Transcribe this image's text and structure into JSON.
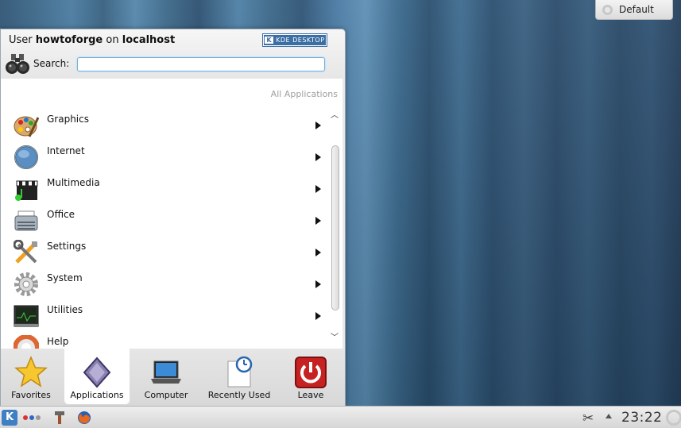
{
  "activity": {
    "label": "Default"
  },
  "launcher": {
    "user_prefix": "User",
    "username": "howtoforge",
    "host_prefix": "on",
    "hostname": "localhost",
    "badge": {
      "k": "K",
      "text": "KDE DESKTOP"
    },
    "search_label": "Search:",
    "search_value": "",
    "breadcrumb": "All Applications",
    "items": [
      {
        "label": "Graphics",
        "icon": "palette-icon"
      },
      {
        "label": "Internet",
        "icon": "globe-icon"
      },
      {
        "label": "Multimedia",
        "icon": "clapperboard-icon"
      },
      {
        "label": "Office",
        "icon": "typewriter-icon"
      },
      {
        "label": "Settings",
        "icon": "tools-icon"
      },
      {
        "label": "System",
        "icon": "gear-icon"
      },
      {
        "label": "Utilities",
        "icon": "terminal-icon"
      },
      {
        "label": "Help",
        "icon": "lifebuoy-icon"
      }
    ],
    "tabs": [
      {
        "label": "Favorites",
        "icon": "star-icon"
      },
      {
        "label": "Applications",
        "icon": "applications-icon"
      },
      {
        "label": "Computer",
        "icon": "laptop-icon"
      },
      {
        "label": "Recently Used",
        "icon": "recent-document-icon"
      },
      {
        "label": "Leave",
        "icon": "power-icon"
      }
    ]
  },
  "taskbar": {
    "clock": "23:22"
  }
}
